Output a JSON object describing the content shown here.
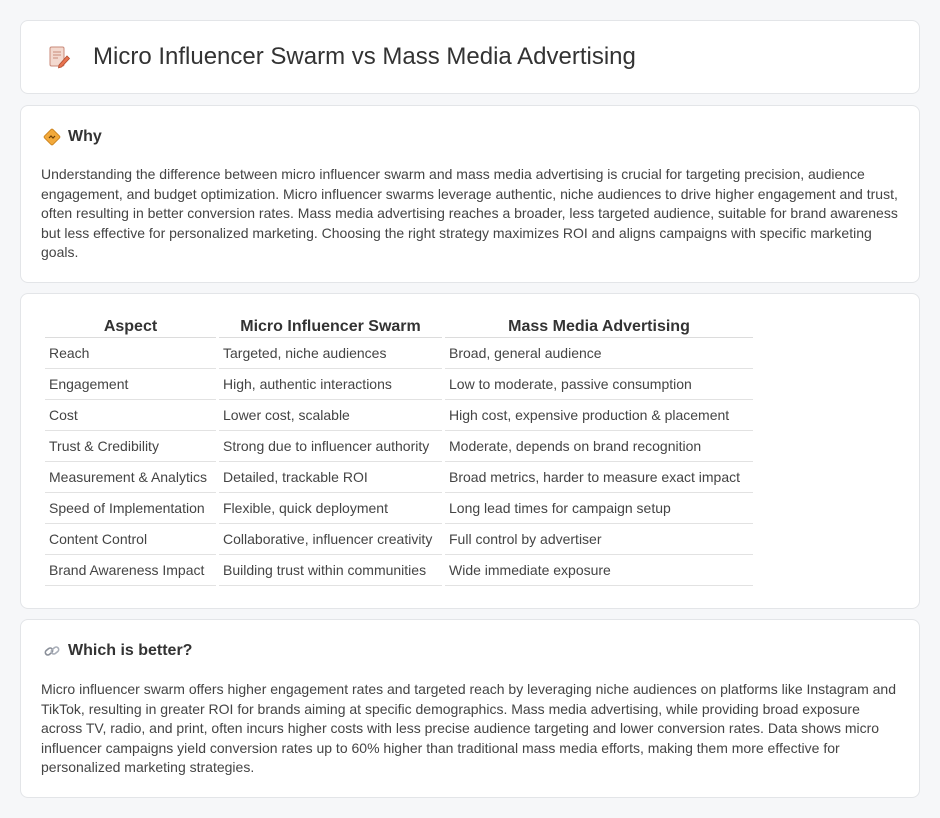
{
  "header": {
    "title": "Micro Influencer Swarm vs Mass Media Advertising",
    "icon": "document-pencil-icon"
  },
  "why": {
    "title": "Why",
    "icon": "diamond-signpost-icon",
    "text": "Understanding the difference between micro influencer swarm and mass media advertising is crucial for targeting precision, audience engagement, and budget optimization. Micro influencer swarms leverage authentic, niche audiences to drive higher engagement and trust, often resulting in better conversion rates. Mass media advertising reaches a broader, less targeted audience, suitable for brand awareness but less effective for personalized marketing. Choosing the right strategy maximizes ROI and aligns campaigns with specific marketing goals."
  },
  "comparison": {
    "headers": [
      "Aspect",
      "Micro Influencer Swarm",
      "Mass Media Advertising"
    ],
    "rows": [
      [
        "Reach",
        "Targeted, niche audiences",
        "Broad, general audience"
      ],
      [
        "Engagement",
        "High, authentic interactions",
        "Low to moderate, passive consumption"
      ],
      [
        "Cost",
        "Lower cost, scalable",
        "High cost, expensive production & placement"
      ],
      [
        "Trust & Credibility",
        "Strong due to influencer authority",
        "Moderate, depends on brand recognition"
      ],
      [
        "Measurement & Analytics",
        "Detailed, trackable ROI",
        "Broad metrics, harder to measure exact impact"
      ],
      [
        "Speed of Implementation",
        "Flexible, quick deployment",
        "Long lead times for campaign setup"
      ],
      [
        "Content Control",
        "Collaborative, influencer creativity",
        "Full control by advertiser"
      ],
      [
        "Brand Awareness Impact",
        "Building trust within communities",
        "Wide immediate exposure"
      ]
    ]
  },
  "better": {
    "title": "Which is better?",
    "icon": "link-icon",
    "text": "Micro influencer swarm offers higher engagement rates and targeted reach by leveraging niche audiences on platforms like Instagram and TikTok, resulting in greater ROI for brands aiming at specific demographics. Mass media advertising, while providing broad exposure across TV, radio, and print, often incurs higher costs with less precise audience targeting and lower conversion rates. Data shows micro influencer campaigns yield conversion rates up to 60% higher than traditional mass media efforts, making them more effective for personalized marketing strategies."
  }
}
